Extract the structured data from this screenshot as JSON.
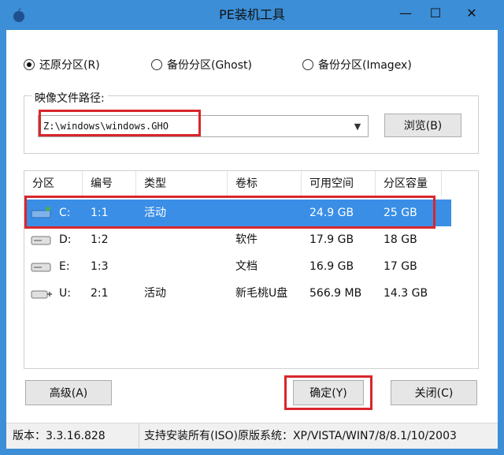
{
  "window": {
    "title": "PE装机工具",
    "minimize_glyph": "—",
    "maximize_glyph": "☐",
    "close_glyph": "✕"
  },
  "modes": [
    {
      "label": "还原分区(R)",
      "selected": true
    },
    {
      "label": "备份分区(Ghost)",
      "selected": false
    },
    {
      "label": "备份分区(Imagex)",
      "selected": false
    }
  ],
  "image": {
    "label": "映像文件路径:",
    "path": "Z:\\windows\\windows.GHO",
    "browse_label": "浏览(B)"
  },
  "table": {
    "columns": [
      "分区",
      "编号",
      "类型",
      "卷标",
      "可用空间",
      "分区容量"
    ],
    "rows": [
      {
        "drive": "C:",
        "num": "1:1",
        "type": "活动",
        "volume": "",
        "free": "24.9 GB",
        "size": "25 GB",
        "icon": "system-drive-icon",
        "selected": true
      },
      {
        "drive": "D:",
        "num": "1:2",
        "type": "",
        "volume": "软件",
        "free": "17.9 GB",
        "size": "18 GB",
        "icon": "hard-drive-icon",
        "selected": false
      },
      {
        "drive": "E:",
        "num": "1:3",
        "type": "",
        "volume": "文档",
        "free": "16.9 GB",
        "size": "17 GB",
        "icon": "hard-drive-icon",
        "selected": false
      },
      {
        "drive": "U:",
        "num": "2:1",
        "type": "活动",
        "volume": "新毛桃U盘",
        "free": "566.9 MB",
        "size": "14.3 GB",
        "icon": "usb-drive-icon",
        "selected": false
      }
    ]
  },
  "buttons": {
    "advanced": "高级(A)",
    "ok": "确定(Y)",
    "close": "关闭(C)"
  },
  "status": {
    "version": "版本：3.3.16.828",
    "support": "支持安装所有(ISO)原版系统：XP/VISTA/WIN7/8/8.1/10/2003"
  },
  "colors": {
    "titlebar": "#3c8ed6",
    "selection": "#3a8ee6",
    "highlight_box": "#d9262c"
  }
}
